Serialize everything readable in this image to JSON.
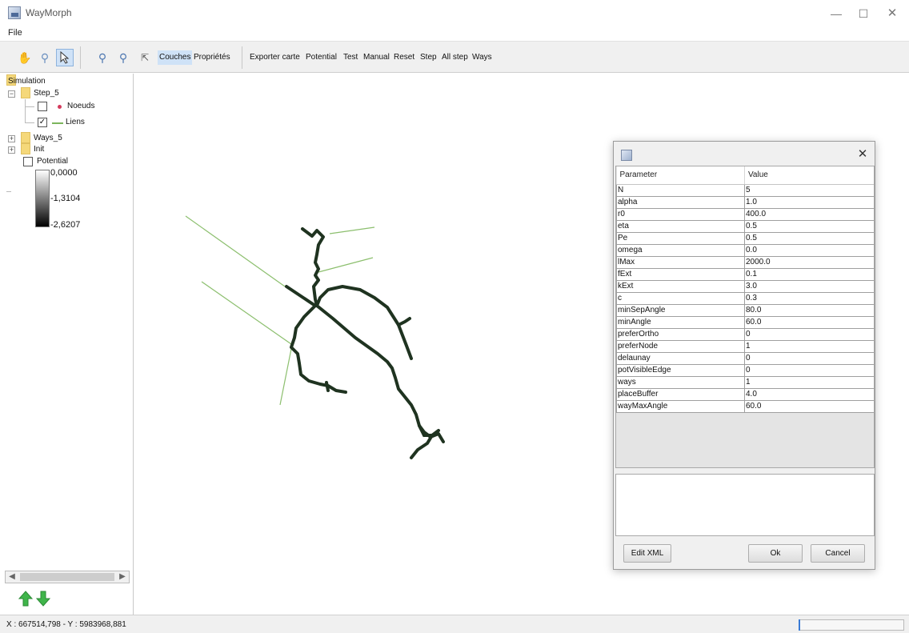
{
  "window": {
    "title": "WayMorph"
  },
  "menu": {
    "file": "File"
  },
  "toolbar": {
    "icons": [
      "pan-hand-icon",
      "magnifier-icon",
      "select-arrow-icon",
      "zoom-in-icon",
      "zoom-out-icon",
      "zoom-extent-icon"
    ],
    "couches": "Couches",
    "proprietes": "Propriétés",
    "actions": [
      "Exporter carte",
      "Potential",
      "Test",
      "Manual",
      "Reset",
      "Step",
      "All step",
      "Ways"
    ]
  },
  "tree": {
    "simulation": "Simulation",
    "step": "Step_5",
    "noeuds": "Noeuds",
    "liens": "Liens",
    "ways": "Ways_5",
    "init": "Init",
    "potential": "Potential",
    "legend": [
      "0,0000",
      "-1,3104",
      "-2,6207"
    ]
  },
  "status": {
    "coords": "X : 667514,798 - Y : 5983968,881"
  },
  "dialog": {
    "headers": {
      "param": "Parameter",
      "value": "Value"
    },
    "rows": [
      [
        "N",
        "5"
      ],
      [
        "alpha",
        "1.0"
      ],
      [
        "r0",
        "400.0"
      ],
      [
        "eta",
        "0.5"
      ],
      [
        "Pe",
        "0.5"
      ],
      [
        "omega",
        "0.0"
      ],
      [
        "lMax",
        "2000.0"
      ],
      [
        "fExt",
        "0.1"
      ],
      [
        "kExt",
        "3.0"
      ],
      [
        "c",
        "0.3"
      ],
      [
        "minSepAngle",
        "80.0"
      ],
      [
        "minAngle",
        "60.0"
      ],
      [
        "preferOrtho",
        "0"
      ],
      [
        "preferNode",
        "1"
      ],
      [
        "delaunay",
        "0"
      ],
      [
        "potVisibleEdge",
        "0"
      ],
      [
        "ways",
        "1"
      ],
      [
        "placeBuffer",
        "4.0"
      ],
      [
        "wayMaxAngle",
        "60.0"
      ]
    ],
    "edit_xml": "Edit XML",
    "ok": "Ok",
    "cancel": "Cancel"
  },
  "colors": {
    "network": "#1f3320",
    "links": "#8cbf6e",
    "noeud_dot": "#d43a5c",
    "folder": "#f5d87a",
    "selection": "#cfe2f7"
  }
}
